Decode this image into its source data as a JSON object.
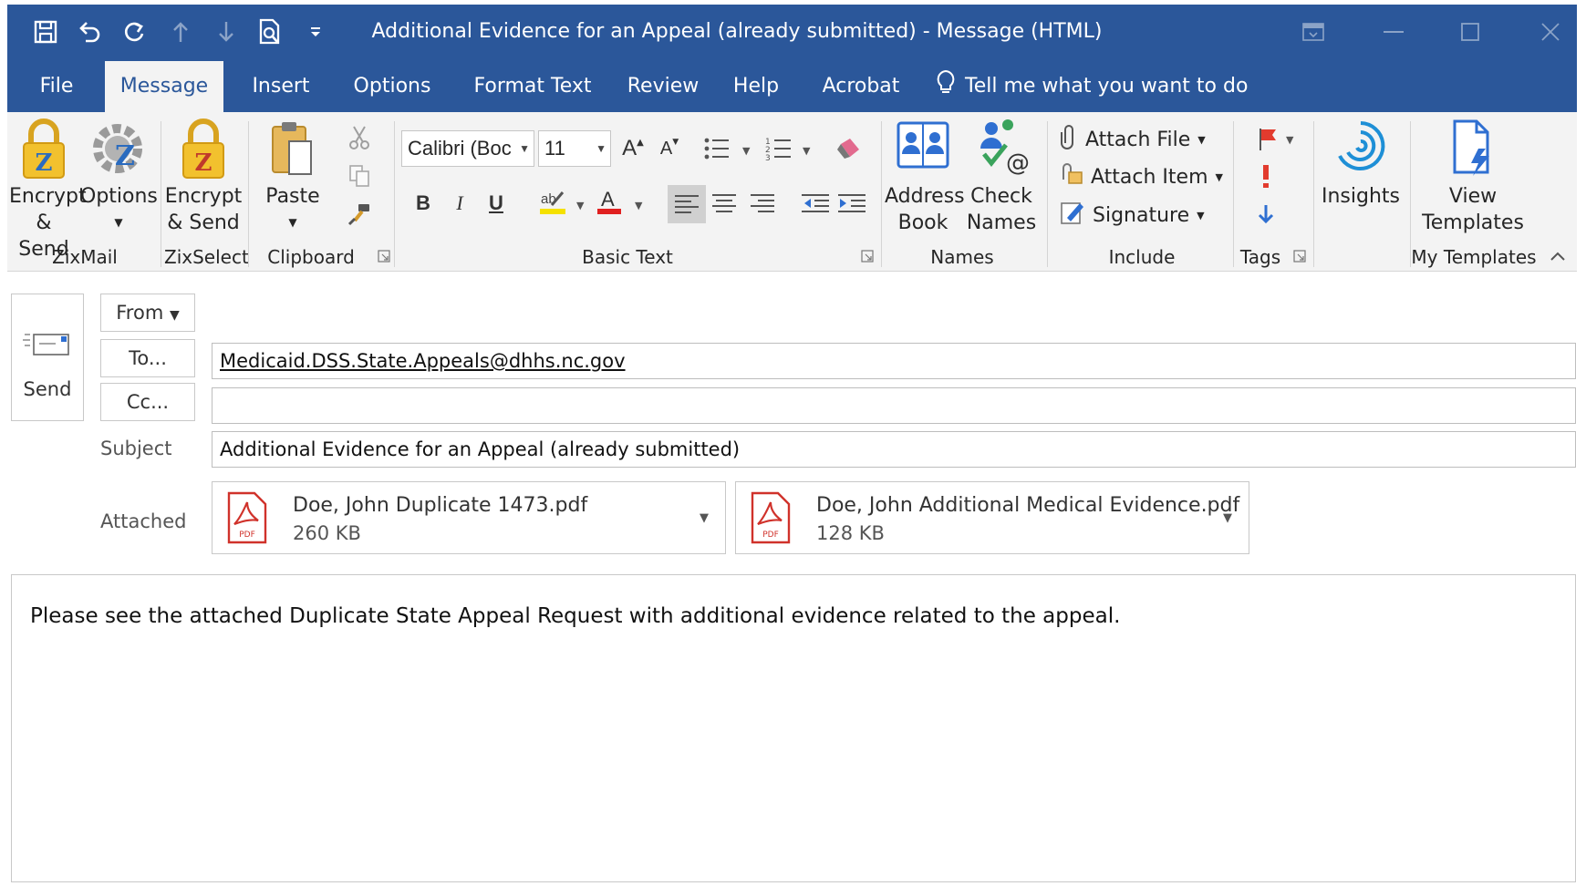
{
  "window": {
    "title": "Additional Evidence for an Appeal (already submitted)  -  Message (HTML)"
  },
  "tabs": [
    "File",
    "Message",
    "Insert",
    "Options",
    "Format Text",
    "Review",
    "Help",
    "Acrobat"
  ],
  "tell_me": "Tell me what you want to do",
  "ribbon": {
    "zixmail": {
      "encrypt_send": [
        "Encrypt",
        "& Send"
      ],
      "options": "Options",
      "label": "ZixMail"
    },
    "zixselect": {
      "encrypt_send": [
        "Encrypt",
        "& Send"
      ],
      "label": "ZixSelect"
    },
    "clipboard": {
      "paste": "Paste",
      "label": "Clipboard"
    },
    "basic_text": {
      "font": "Calibri (Boc",
      "size": "11",
      "bold": "B",
      "italic": "I",
      "underline": "U",
      "label": "Basic Text"
    },
    "names": {
      "address_book": [
        "Address",
        "Book"
      ],
      "check_names": [
        "Check",
        "Names"
      ],
      "label": "Names"
    },
    "include": {
      "attach_file": "Attach File",
      "attach_item": "Attach Item",
      "signature": "Signature",
      "label": "Include"
    },
    "tags": {
      "label": "Tags"
    },
    "insights": {
      "label": "Insights"
    },
    "my_templates": {
      "view_templates": [
        "View",
        "Templates"
      ],
      "label": "My Templates"
    }
  },
  "message": {
    "send_label": "Send",
    "from_label": "From",
    "to_label": "To...",
    "cc_label": "Cc...",
    "subject_label": "Subject",
    "attached_label": "Attached",
    "to_value": "Medicaid.DSS.State.Appeals@dhhs.nc.gov",
    "cc_value": "",
    "subject_value": "Additional Evidence for an Appeal (already submitted)",
    "attachments": [
      {
        "name": "Doe, John Duplicate 1473.pdf",
        "size": "260 KB"
      },
      {
        "name": "Doe, John Additional Medical Evidence.pdf",
        "size": "128 KB"
      }
    ],
    "body": "Please see the attached Duplicate State Appeal Request with additional evidence related to the appeal."
  },
  "colors": {
    "accent": "#2b579a",
    "ribbon_bg": "#f3f3f3",
    "zix_gold": "#f2c12e",
    "zix_red": "#c0392b",
    "flag_red": "#e23b2e",
    "arrow_blue": "#2f6fd1"
  }
}
